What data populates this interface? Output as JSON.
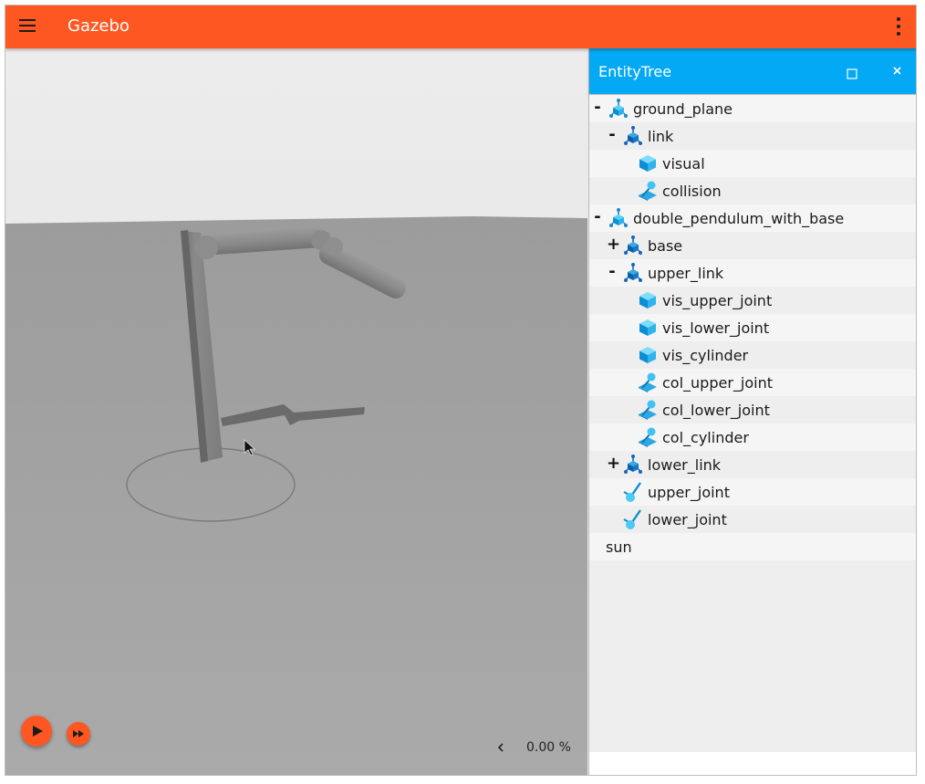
{
  "app": {
    "title": "Gazebo",
    "accent": "#ff5722",
    "menu_icon": "hamburger-icon",
    "overflow_icon": "more-vert-icon"
  },
  "viewport": {
    "rtf": "0.00 %",
    "play_icon": "play-icon",
    "step_icon": "fast-forward-icon",
    "collapse_icon": "chevron-left-icon"
  },
  "entity_tree": {
    "title": "EntityTree",
    "header_color": "#03a9f4",
    "maximize_icon": "maximize-icon",
    "close_icon": "close-icon",
    "items": [
      {
        "label": "ground_plane",
        "toggle": "-",
        "type": "model",
        "depth": 0
      },
      {
        "label": "link",
        "toggle": "-",
        "type": "link",
        "depth": 1
      },
      {
        "label": "visual",
        "toggle": "",
        "type": "visual",
        "depth": 2
      },
      {
        "label": "collision",
        "toggle": "",
        "type": "collision",
        "depth": 2
      },
      {
        "label": "double_pendulum_with_base",
        "toggle": "-",
        "type": "model",
        "depth": 0
      },
      {
        "label": "base",
        "toggle": "+",
        "type": "link",
        "depth": 1
      },
      {
        "label": "upper_link",
        "toggle": "-",
        "type": "link",
        "depth": 1
      },
      {
        "label": "vis_upper_joint",
        "toggle": "",
        "type": "visual",
        "depth": 2
      },
      {
        "label": "vis_lower_joint",
        "toggle": "",
        "type": "visual",
        "depth": 2
      },
      {
        "label": "vis_cylinder",
        "toggle": "",
        "type": "visual",
        "depth": 2
      },
      {
        "label": "col_upper_joint",
        "toggle": "",
        "type": "collision",
        "depth": 2
      },
      {
        "label": "col_lower_joint",
        "toggle": "",
        "type": "collision",
        "depth": 2
      },
      {
        "label": "col_cylinder",
        "toggle": "",
        "type": "collision",
        "depth": 2
      },
      {
        "label": "lower_link",
        "toggle": "+",
        "type": "link",
        "depth": 1
      },
      {
        "label": "upper_joint",
        "toggle": "",
        "type": "joint",
        "depth": 1
      },
      {
        "label": "lower_joint",
        "toggle": "",
        "type": "joint",
        "depth": 1
      },
      {
        "label": "sun",
        "toggle": "",
        "type": "light",
        "depth": 0
      }
    ]
  }
}
